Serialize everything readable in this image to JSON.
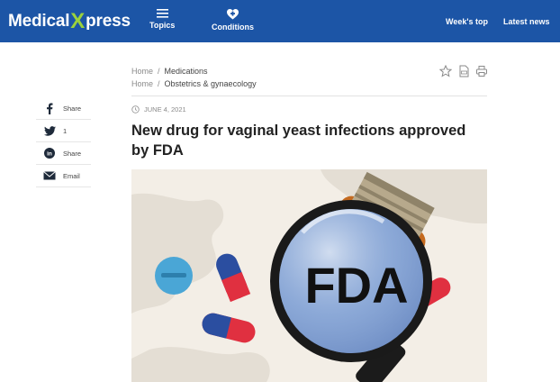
{
  "header": {
    "logo_left": "Medical",
    "logo_x": "X",
    "logo_right": "press",
    "nav": [
      {
        "label": "Topics",
        "icon": "menu-icon"
      },
      {
        "label": "Conditions",
        "icon": "medical-cross-icon"
      }
    ],
    "links": [
      "Week's top",
      "Latest news"
    ]
  },
  "breadcrumbs": [
    {
      "home": "Home",
      "section": "Medications"
    },
    {
      "home": "Home",
      "section": "Obstetrics & gynaecology"
    }
  ],
  "article": {
    "date": "JUNE 4, 2021",
    "title": "New drug for vaginal yeast infections approved by FDA"
  },
  "share": [
    {
      "icon": "facebook-icon",
      "label": "Share"
    },
    {
      "icon": "twitter-icon",
      "label": "1"
    },
    {
      "icon": "linkedin-icon",
      "label": "Share"
    },
    {
      "icon": "email-icon",
      "label": "Email"
    }
  ],
  "hero": {
    "magnifier_text": "FDA"
  },
  "colors": {
    "header_bg": "#1c55a6",
    "logo_accent": "#9bd23c"
  }
}
